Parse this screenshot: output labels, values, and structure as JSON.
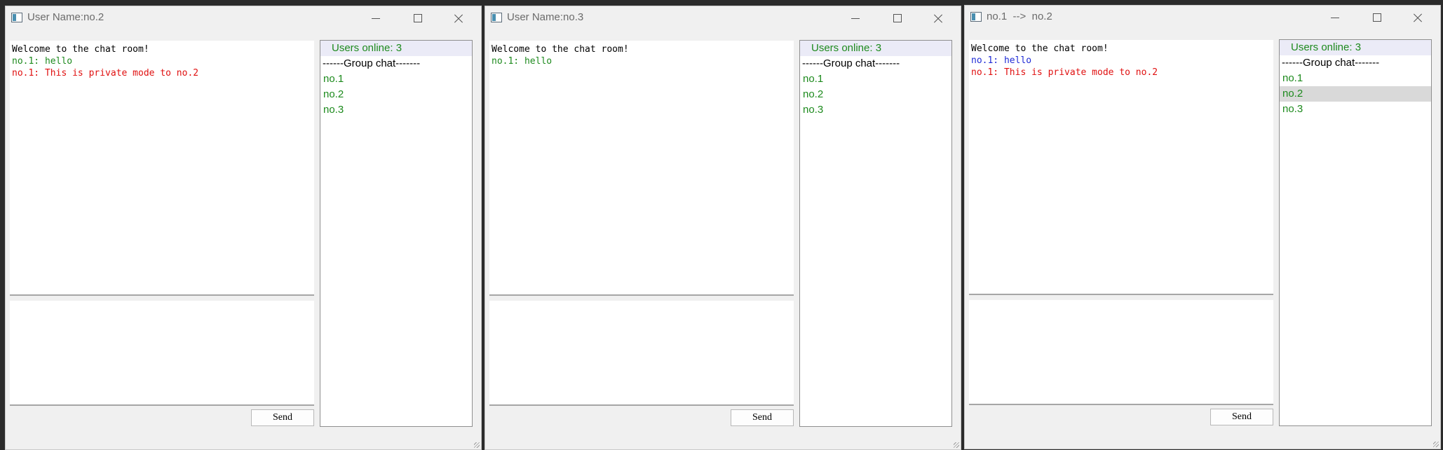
{
  "windows": [
    {
      "title": "User Name:no.2",
      "messages": [
        {
          "text": "Welcome to the chat room!",
          "color": "#000000"
        },
        {
          "text": "no.1: hello",
          "color": "#1d8a1d"
        },
        {
          "text": "no.1: This is private mode to no.2",
          "color": "#e01010"
        }
      ],
      "input_value": "",
      "send_label": "Send",
      "online_label": "Users online: 3",
      "group_label": "------Group chat-------",
      "users": [
        "no.1",
        "no.2",
        "no.3"
      ],
      "selected_user": null
    },
    {
      "title": "User Name:no.3",
      "messages": [
        {
          "text": "Welcome to the chat room!",
          "color": "#000000"
        },
        {
          "text": "no.1: hello",
          "color": "#1d8a1d"
        }
      ],
      "input_value": "",
      "send_label": "Send",
      "online_label": "Users online: 3",
      "group_label": "------Group chat-------",
      "users": [
        "no.1",
        "no.2",
        "no.3"
      ],
      "selected_user": null
    },
    {
      "title": "no.1  -->  no.2",
      "messages": [
        {
          "text": "Welcome to the chat room!",
          "color": "#000000"
        },
        {
          "text": "no.1: hello",
          "color": "#1f2bd6"
        },
        {
          "text": "no.1: This is private mode to no.2",
          "color": "#e01010"
        }
      ],
      "input_value": "",
      "send_label": "Send",
      "online_label": "Users online: 3",
      "group_label": "------Group chat-------",
      "users": [
        "no.1",
        "no.2",
        "no.3"
      ],
      "selected_user": 1
    }
  ]
}
